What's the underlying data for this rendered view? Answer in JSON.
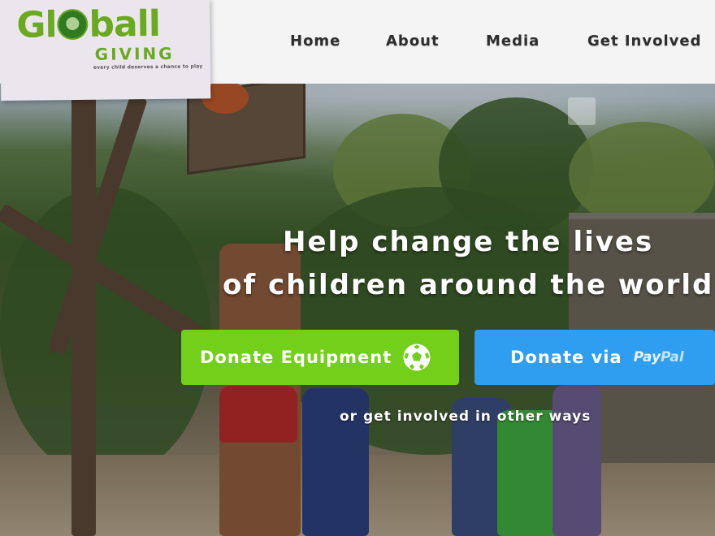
{
  "brand": {
    "logo_main": [
      "Gl",
      "ball"
    ],
    "logo_sub": "GIVING",
    "tagline": "every child deserves a chance to play",
    "accent_color": "#72cf1a"
  },
  "nav": {
    "items": [
      "Home",
      "About",
      "Media",
      "Get Involved"
    ]
  },
  "hero": {
    "headline_line1": "Help change the lives",
    "headline_line2": "of children around the world!",
    "donate_equipment_label": "Donate Equipment",
    "donate_paypal_label": "Donate via",
    "paypal_pay": "Pay",
    "paypal_pal": "Pal",
    "other_ways_link": "or get involved in other ways",
    "green_button_color": "#72cf1a",
    "blue_button_color": "#2f9ef0",
    "icons": [
      "soccer-ball-icon",
      "paypal-logo"
    ]
  }
}
